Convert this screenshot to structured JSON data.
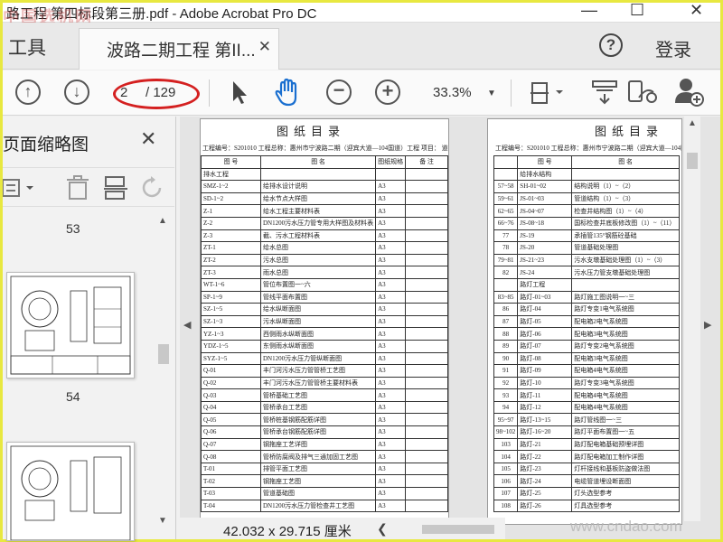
{
  "window": {
    "title": "路工程 第四标段第三册.pdf - Adobe Acrobat Pro DC",
    "watermark_top": "中国选机网",
    "minimize": "—",
    "maximize": "☐",
    "close": "✕"
  },
  "tabs": {
    "tools": "工具",
    "document": "波路二期工程 第II...",
    "document_close": "✕",
    "help": "?",
    "login": "登录"
  },
  "toolbar": {
    "page_current": "2",
    "page_total": "/ 129",
    "zoom": "33.3%"
  },
  "left_panel": {
    "title": "页面缩略图",
    "close": "✕",
    "thumb_numbers": [
      "53",
      "54"
    ]
  },
  "pages": [
    {
      "title": "图纸目录",
      "subtitle": "工程编号：S201010    工程总称：惠州市宁波路二期（迎宾大道—104国道）工程    项目：  道排水、路灯、道路绿化工程",
      "headers": [
        "图    号",
        "图    名",
        "图纸规格",
        "备    注"
      ],
      "rows": [
        [
          "排水工程",
          "",
          "",
          ""
        ],
        [
          "SMZ-1~2",
          "给排水设计说明",
          "A3",
          ""
        ],
        [
          "SD-1~2",
          "给水节点大样图",
          "A3",
          ""
        ],
        [
          "Z-1",
          "给水工程主要材料表",
          "A3",
          ""
        ],
        [
          "Z-2",
          "DN1200污水压力管专用大样图及材料表",
          "A3",
          ""
        ],
        [
          "Z-3",
          "截、污水工程材料表",
          "A3",
          ""
        ],
        [
          "ZT-1",
          "给水总图",
          "A3",
          ""
        ],
        [
          "ZT-2",
          "污水总图",
          "A3",
          ""
        ],
        [
          "ZT-3",
          "雨水总图",
          "A3",
          ""
        ],
        [
          "WT-1~6",
          "管位布置图一~六",
          "A3",
          ""
        ],
        [
          "SP-1~9",
          "管线平面布置图",
          "A3",
          ""
        ],
        [
          "SZ-1~5",
          "给水纵断面图",
          "A3",
          ""
        ],
        [
          "SZ-1~3",
          "污水纵断面图",
          "A3",
          ""
        ],
        [
          "YZ-1~3",
          "西侧雨水纵断面图",
          "A3",
          ""
        ],
        [
          "YDZ-1~5",
          "东侧雨水纵断面图",
          "A3",
          ""
        ],
        [
          "SYZ-1~5",
          "DN1200污水压力管纵断面图",
          "A3",
          ""
        ],
        [
          "Q-01",
          "丰门河污水压力管管桥工艺图",
          "A3",
          ""
        ],
        [
          "Q-02",
          "丰门河污水压力管管桥主要材料表",
          "A3",
          ""
        ],
        [
          "Q-03",
          "管桥基础工艺图",
          "A3",
          ""
        ],
        [
          "Q-04",
          "管桥承台工艺图",
          "A3",
          ""
        ],
        [
          "Q-05",
          "管桥桩基钢筋配筋详图",
          "A3",
          ""
        ],
        [
          "Q-06",
          "管桥承台钢筋配筋详图",
          "A3",
          ""
        ],
        [
          "Q-07",
          "钢拖座工艺详图",
          "A3",
          ""
        ],
        [
          "Q-08",
          "管桥防腐阀及排气三通加固工艺图",
          "A3",
          ""
        ],
        [
          "T-01",
          "排管平面工艺图",
          "A3",
          ""
        ],
        [
          "T-02",
          "钢拖座工艺图",
          "A3",
          ""
        ],
        [
          "T-03",
          "管道基础图",
          "A3",
          ""
        ],
        [
          "T-04",
          "DN1200污水压力管检查井工艺图",
          "A3",
          ""
        ]
      ]
    },
    {
      "title": "图纸目录",
      "subtitle": "工程编号：S201010    工程总称：惠州市宁波路二期（迎宾大道—104国道）工程",
      "headers": [
        "",
        "图    号",
        "图    名"
      ],
      "rows": [
        [
          "",
          "给排水结构",
          ""
        ],
        [
          "57~58",
          "SH-01~02",
          "结构说明（1）~（2）"
        ],
        [
          "59~61",
          "JS-01~03",
          "管道结构（1）~（3）"
        ],
        [
          "62~65",
          "JS-04~07",
          "检查井结构图（1）~（4）"
        ],
        [
          "66~76",
          "JS-08~18",
          "国标检查井底板修改图（1）~（11）"
        ],
        [
          "77",
          "JS-19",
          "承插管135°钢筋砼基础"
        ],
        [
          "78",
          "JS-20",
          "管道基础处理图"
        ],
        [
          "79~81",
          "JS-21~23",
          "污水支墩基础处理图（1）~（3）"
        ],
        [
          "82",
          "JS-24",
          "污水压力管支墩基础处理图"
        ],
        [
          "",
          "路灯工程",
          ""
        ],
        [
          "83~85",
          "路灯-01~03",
          "路灯施工图说明一~三"
        ],
        [
          "86",
          "路灯-04",
          "路灯专变1电气系统图"
        ],
        [
          "87",
          "路灯-05",
          "配电箱2电气系统图"
        ],
        [
          "88",
          "路灯-06",
          "配电箱3电气系统图"
        ],
        [
          "89",
          "路灯-07",
          "路灯专变2电气系统图"
        ],
        [
          "90",
          "路灯-08",
          "配电箱3电气系统图"
        ],
        [
          "91",
          "路灯-09",
          "配电箱4电气系统图"
        ],
        [
          "92",
          "路灯-10",
          "路灯专变3电气系统图"
        ],
        [
          "93",
          "路灯-11",
          "配电箱4电气系统图"
        ],
        [
          "94",
          "路灯-12",
          "配电箱4电气系统图"
        ],
        [
          "95~97",
          "路灯-13~15",
          "路灯管线图一~三"
        ],
        [
          "98~102",
          "路灯-16~20",
          "路灯平面布置图一~五"
        ],
        [
          "103",
          "路灯-21",
          "路灯配电箱基础预埋详图"
        ],
        [
          "104",
          "路灯-22",
          "路灯配电箱加工制作详图"
        ],
        [
          "105",
          "路灯-23",
          "灯杆接线和基板防盗做法图"
        ],
        [
          "106",
          "路灯-24",
          "电缆管道埋设断面图"
        ],
        [
          "107",
          "路灯-25",
          "灯头选型参考"
        ],
        [
          "108",
          "路灯-26",
          "灯具选型参考"
        ]
      ]
    }
  ],
  "status": {
    "dimensions": "42.032 x 29.715 厘米"
  },
  "watermark": "www.cndao.com",
  "colors": {
    "annotation_red": "#d42020",
    "hand_tool_blue": "#1a6fd0",
    "frame_yellow": "#e8e840"
  }
}
